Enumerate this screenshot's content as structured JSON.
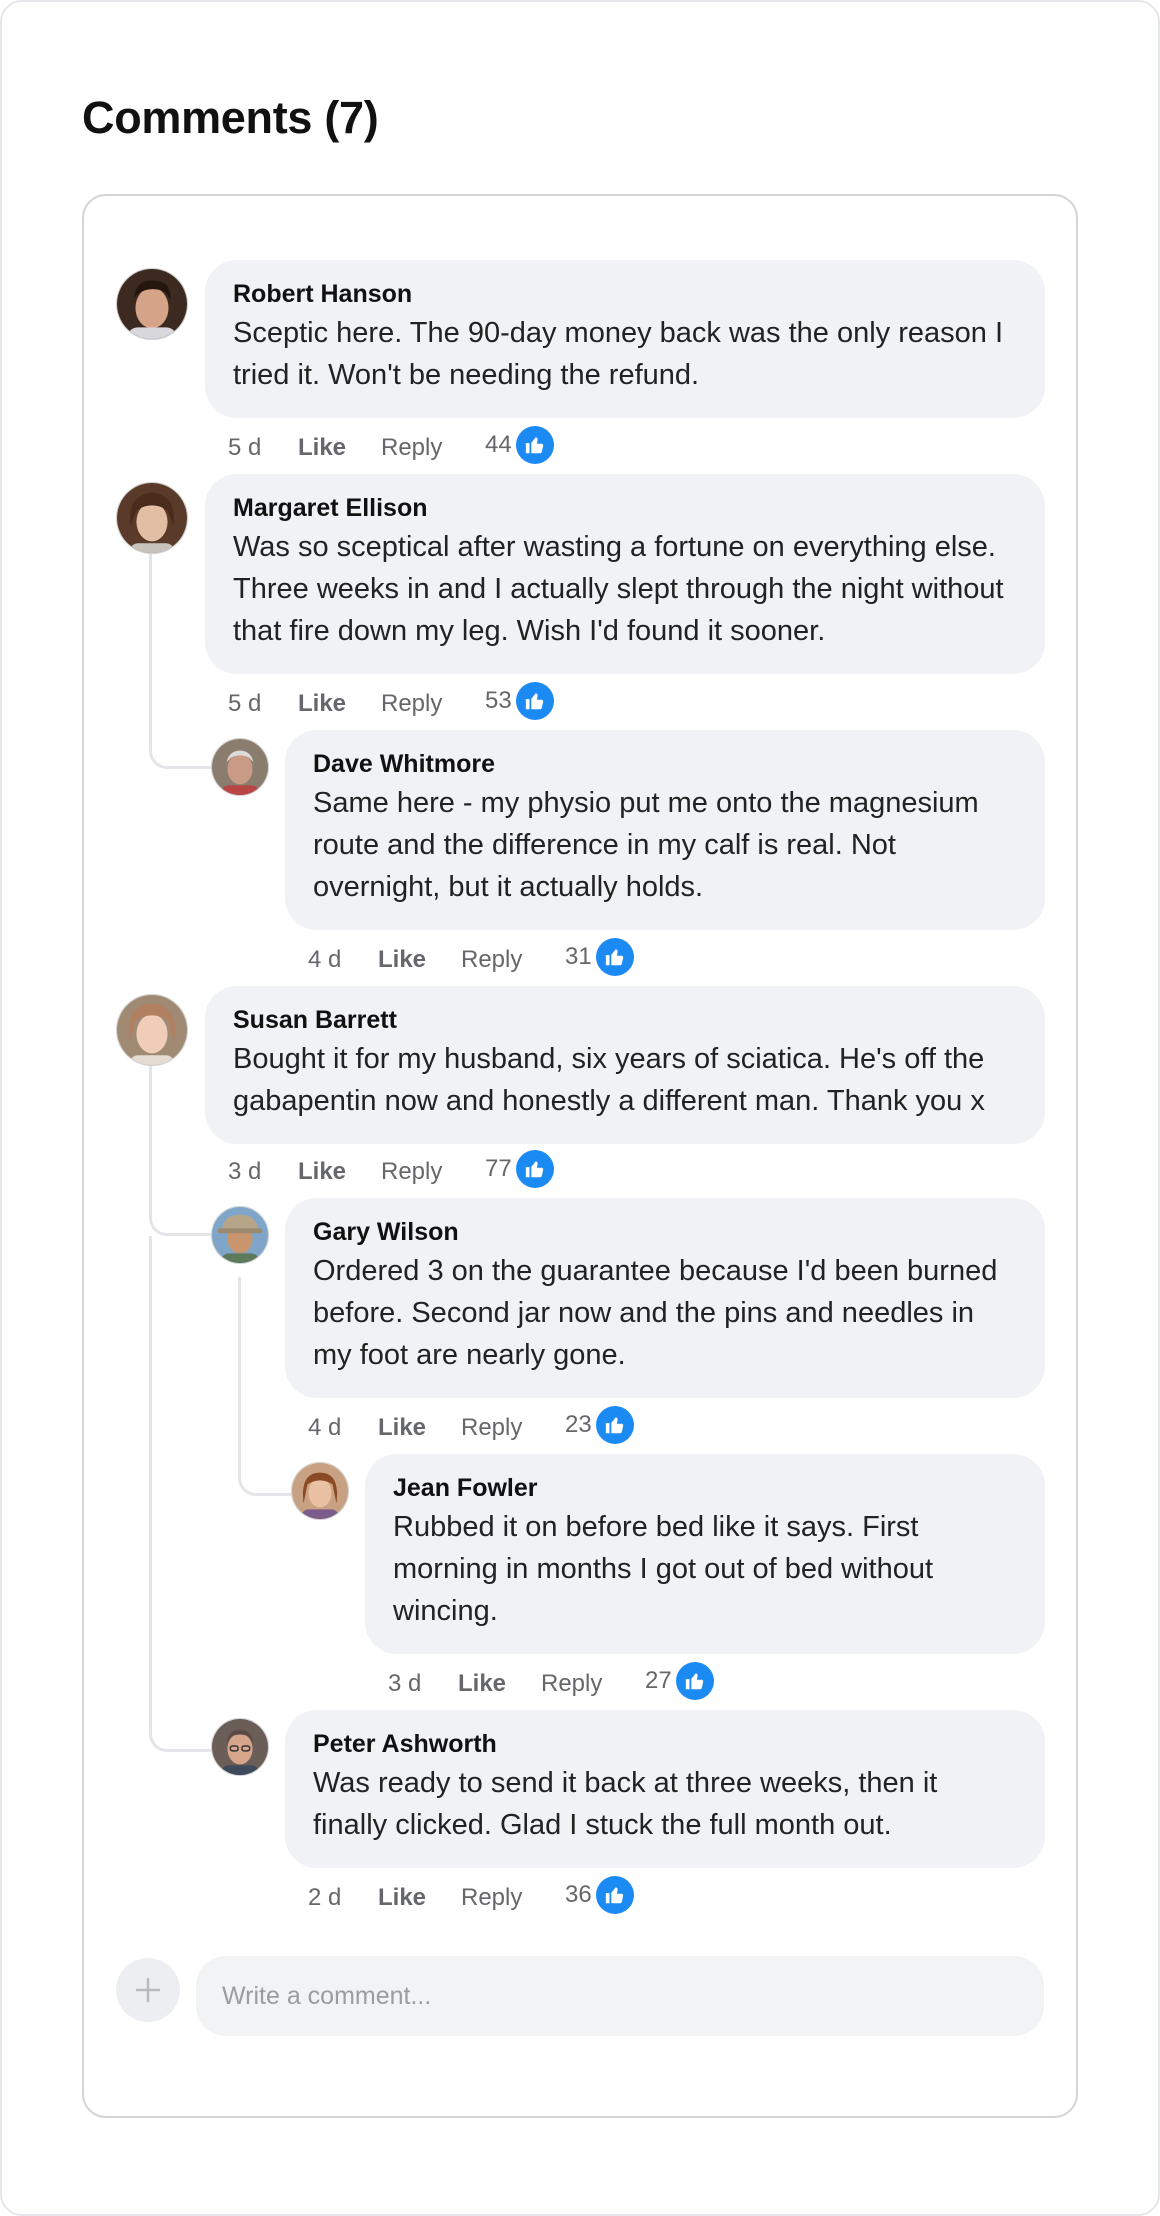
{
  "header": {
    "title": "Comments (7)"
  },
  "comments": [
    {
      "author": "Robert Hanson",
      "text": "Sceptic here. The 90-day money back was the only reason I tried it. Won't be needing the refund.",
      "time": "5 d",
      "like_label": "Like",
      "reply_label": "Reply",
      "likes": "44"
    },
    {
      "author": "Margaret Ellison",
      "text": "Was so sceptical after wasting a fortune on everything else. Three weeks in and I actually slept through the night without that fire down my leg. Wish I'd found it sooner.",
      "time": "5 d",
      "like_label": "Like",
      "reply_label": "Reply",
      "likes": "53"
    },
    {
      "author": "Dave Whitmore",
      "text": "Same here - my physio put me onto the magnesium route and the difference in my calf is real. Not overnight, but it actually holds.",
      "time": "4 d",
      "like_label": "Like",
      "reply_label": "Reply",
      "likes": "31"
    },
    {
      "author": "Susan Barrett",
      "text": "Bought it for my husband, six years of sciatica. He's off the gabapentin now and honestly a different man. Thank you x",
      "time": "3 d",
      "like_label": "Like",
      "reply_label": "Reply",
      "likes": "77"
    },
    {
      "author": "Gary Wilson",
      "text": "Ordered 3 on the guarantee because I'd been burned before. Second jar now and the pins and needles in my foot are nearly gone.",
      "time": "4 d",
      "like_label": "Like",
      "reply_label": "Reply",
      "likes": "23"
    },
    {
      "author": "Jean Fowler",
      "text": "Rubbed it on before bed like it says. First morning in months I got out of bed without wincing.",
      "time": "3 d",
      "like_label": "Like",
      "reply_label": "Reply",
      "likes": "27"
    },
    {
      "author": "Peter Ashworth",
      "text": "Was ready to send it back at three weeks, then it finally clicked. Glad I stuck the full month out.",
      "time": "2 d",
      "like_label": "Like",
      "reply_label": "Reply",
      "likes": "36"
    }
  ],
  "composer": {
    "placeholder": "Write a comment..."
  },
  "colors": {
    "like_badge": "#1b8af2",
    "bubble": "#f0f2f5",
    "meta_text": "#65676b",
    "thread_line": "#e3e5e8"
  },
  "icons": {
    "like": "thumbs-up-icon",
    "add": "plus-icon"
  }
}
